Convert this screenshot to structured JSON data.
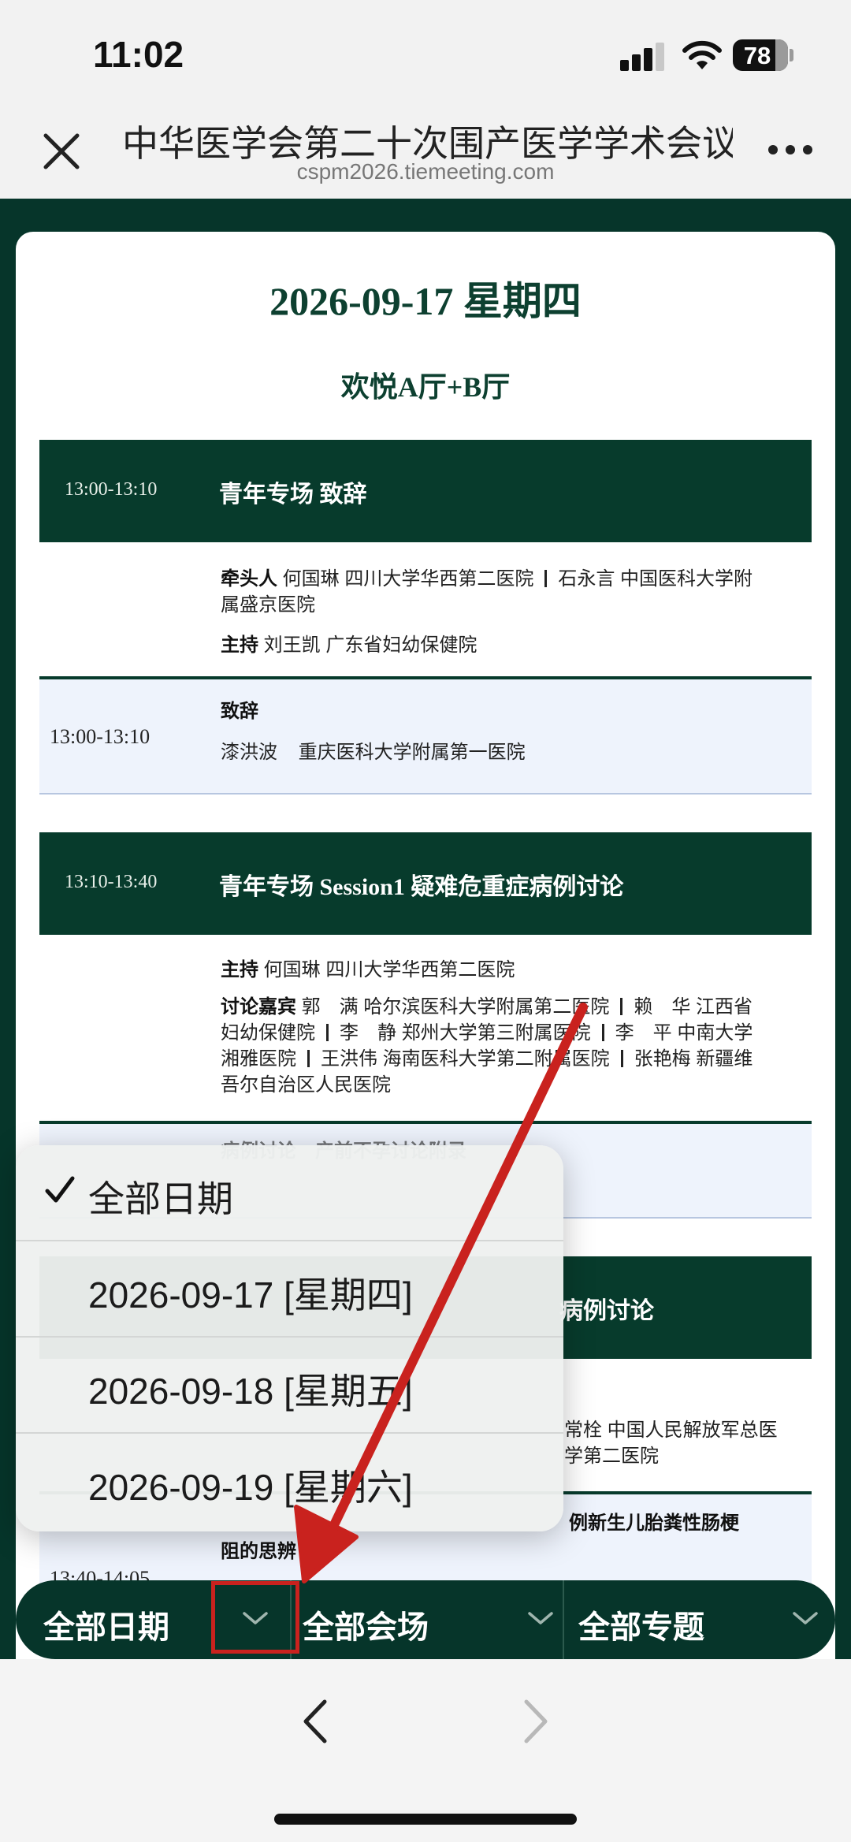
{
  "status_bar": {
    "time": "11:02",
    "battery": "78"
  },
  "browser": {
    "title": "中华医学会第二十次围产医学学术会议",
    "url": "cspm2026.tiemeeting.com"
  },
  "schedule": {
    "date_heading": "2026-09-17 星期四",
    "hall_heading": "欢悦A厅+B厅",
    "section1": {
      "time": "13:00-13:10",
      "title": "青年专场 致辞",
      "leaders_label": "牵头人",
      "leaders_line1_a": "何国琳 四川大学华西第二医院",
      "leaders_line1_b": "石永言 中国医科大学附",
      "leaders_line2": "属盛京医院",
      "host_label": "主持",
      "host": "刘王凯 广东省妇幼保健院",
      "talk": {
        "time": "13:00-13:10",
        "title": "致辞",
        "speaker": "漆洪波    重庆医科大学附属第一医院"
      }
    },
    "section2": {
      "time": "13:10-13:40",
      "title": "青年专场 Session1 疑难危重症病例讨论",
      "host_label": "主持",
      "host": "何国琳 四川大学华西第二医院",
      "guests_label": "讨论嘉宾",
      "guests_line1_a": "郭　满 哈尔滨医科大学附属第二医院",
      "guests_line1_b": "赖　华 江西省",
      "guests_line2_a": "妇幼保健院",
      "guests_line2_b": "李　静 郑州大学第三附属医院",
      "guests_line2_c": "李　平 中南大学",
      "guests_line3_a": "湘雅医院",
      "guests_line3_b": "王洪伟 海南医科大学第二附属医院",
      "guests_line3_c": "张艳梅 新疆维",
      "guests_line4": "吾尔自治区人民医院",
      "partial_talk": "病例讨论　产前不孕讨论附录"
    },
    "section3": {
      "title_tail": "病例讨论",
      "info_line1": "常栓 中国人民解放军总医",
      "info_line2": "学第二医院",
      "talk_time": "13:40-14:05",
      "talk_title_1": "例新生儿胎粪性肠梗",
      "talk_title_2": "阻的思辨"
    }
  },
  "dropdown": {
    "items": [
      {
        "label": "全部日期",
        "selected": true
      },
      {
        "label": "2026-09-17 [星期四]",
        "selected": false
      },
      {
        "label": "2026-09-18 [星期五]",
        "selected": false
      },
      {
        "label": "2026-09-19 [星期六]",
        "selected": false
      }
    ]
  },
  "filters": {
    "date": "全部日期",
    "venue": "全部会场",
    "topic": "全部专题"
  },
  "colors": {
    "brand_dark_green": "#073b2c",
    "annotation_red": "#c9221e",
    "talk_bg": "#eef3fc"
  }
}
